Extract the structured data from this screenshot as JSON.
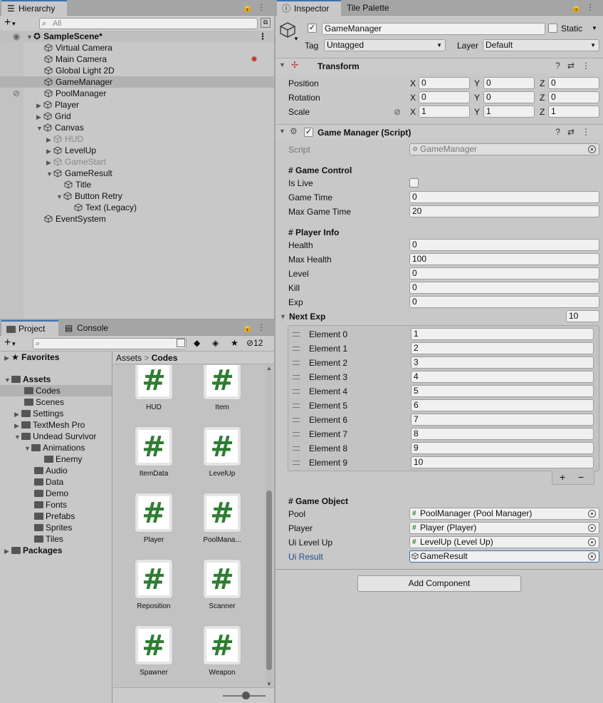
{
  "hierarchy": {
    "tab": "Hierarchy",
    "search_placeholder": "All",
    "scene": "SampleScene*",
    "items": [
      "Virtual Camera",
      "Main Camera",
      "Global Light 2D",
      "GameManager",
      "PoolManager",
      "Player",
      "Grid",
      "Canvas",
      "HUD",
      "LevelUp",
      "GameStart",
      "GameResult",
      "Title",
      "Button Retry",
      "Text (Legacy)",
      "EventSystem"
    ]
  },
  "project": {
    "tab": "Project",
    "console_tab": "Console",
    "hidden_count": "12",
    "breadcrumb": [
      "Assets",
      "Codes"
    ],
    "favorites": "Favorites",
    "assets": "Assets",
    "folders": [
      "Codes",
      "Scenes",
      "Settings",
      "TextMesh Pro",
      "Undead Survivor",
      "Animations",
      "Enemy",
      "Audio",
      "Data",
      "Demo",
      "Fonts",
      "Prefabs",
      "Sprites",
      "Tiles"
    ],
    "packages": "Packages",
    "files": [
      "HUD",
      "Item",
      "ItemData",
      "LevelUp",
      "Player",
      "PoolMana...",
      "Reposition",
      "Scanner",
      "Spawner",
      "Weapon"
    ],
    "file_glyph": "#"
  },
  "inspector": {
    "tab": "Inspector",
    "tile_tab": "Tile Palette",
    "name": "GameManager",
    "static_label": "Static",
    "tag_label": "Tag",
    "tag": "Untagged",
    "layer_label": "Layer",
    "layer": "Default",
    "transform": {
      "title": "Transform",
      "rows": [
        {
          "label": "Position",
          "x": "0",
          "y": "0",
          "z": "0"
        },
        {
          "label": "Rotation",
          "x": "0",
          "y": "0",
          "z": "0"
        },
        {
          "label": "Scale",
          "x": "1",
          "y": "1",
          "z": "1"
        }
      ]
    },
    "script": {
      "title": "Game Manager (Script)",
      "script_label": "Script",
      "script_value": "GameManager",
      "game_control": "# Game Control",
      "is_live": "Is Live",
      "game_time_label": "Game Time",
      "game_time": "0",
      "max_game_time_label": "Max Game Time",
      "max_game_time": "20",
      "player_info": "# Player Info",
      "health_label": "Health",
      "health": "0",
      "max_health_label": "Max Health",
      "max_health": "100",
      "level_label": "Level",
      "level": "0",
      "kill_label": "Kill",
      "kill": "0",
      "exp_label": "Exp",
      "exp": "0",
      "next_exp_label": "Next Exp",
      "next_exp_size": "10",
      "elements": [
        {
          "label": "Element 0",
          "value": "1"
        },
        {
          "label": "Element 1",
          "value": "2"
        },
        {
          "label": "Element 2",
          "value": "3"
        },
        {
          "label": "Element 3",
          "value": "4"
        },
        {
          "label": "Element 4",
          "value": "5"
        },
        {
          "label": "Element 5",
          "value": "6"
        },
        {
          "label": "Element 6",
          "value": "7"
        },
        {
          "label": "Element 7",
          "value": "8"
        },
        {
          "label": "Element 8",
          "value": "9"
        },
        {
          "label": "Element 9",
          "value": "10"
        }
      ],
      "game_object": "# Game Object",
      "pool_label": "Pool",
      "pool": "PoolManager (Pool Manager)",
      "player_label": "Player",
      "player": "Player (Player)",
      "ui_level_up_label": "Ui Level Up",
      "ui_level_up": "LevelUp (Level Up)",
      "ui_result_label": "Ui Result",
      "ui_result": "GameResult"
    },
    "add_component": "Add Component"
  },
  "colors": {
    "accent": "#3a72b0",
    "script_green": "#2e7d32",
    "panel_bg": "#c8c8c8",
    "selected_row": "#b2b2b2"
  }
}
